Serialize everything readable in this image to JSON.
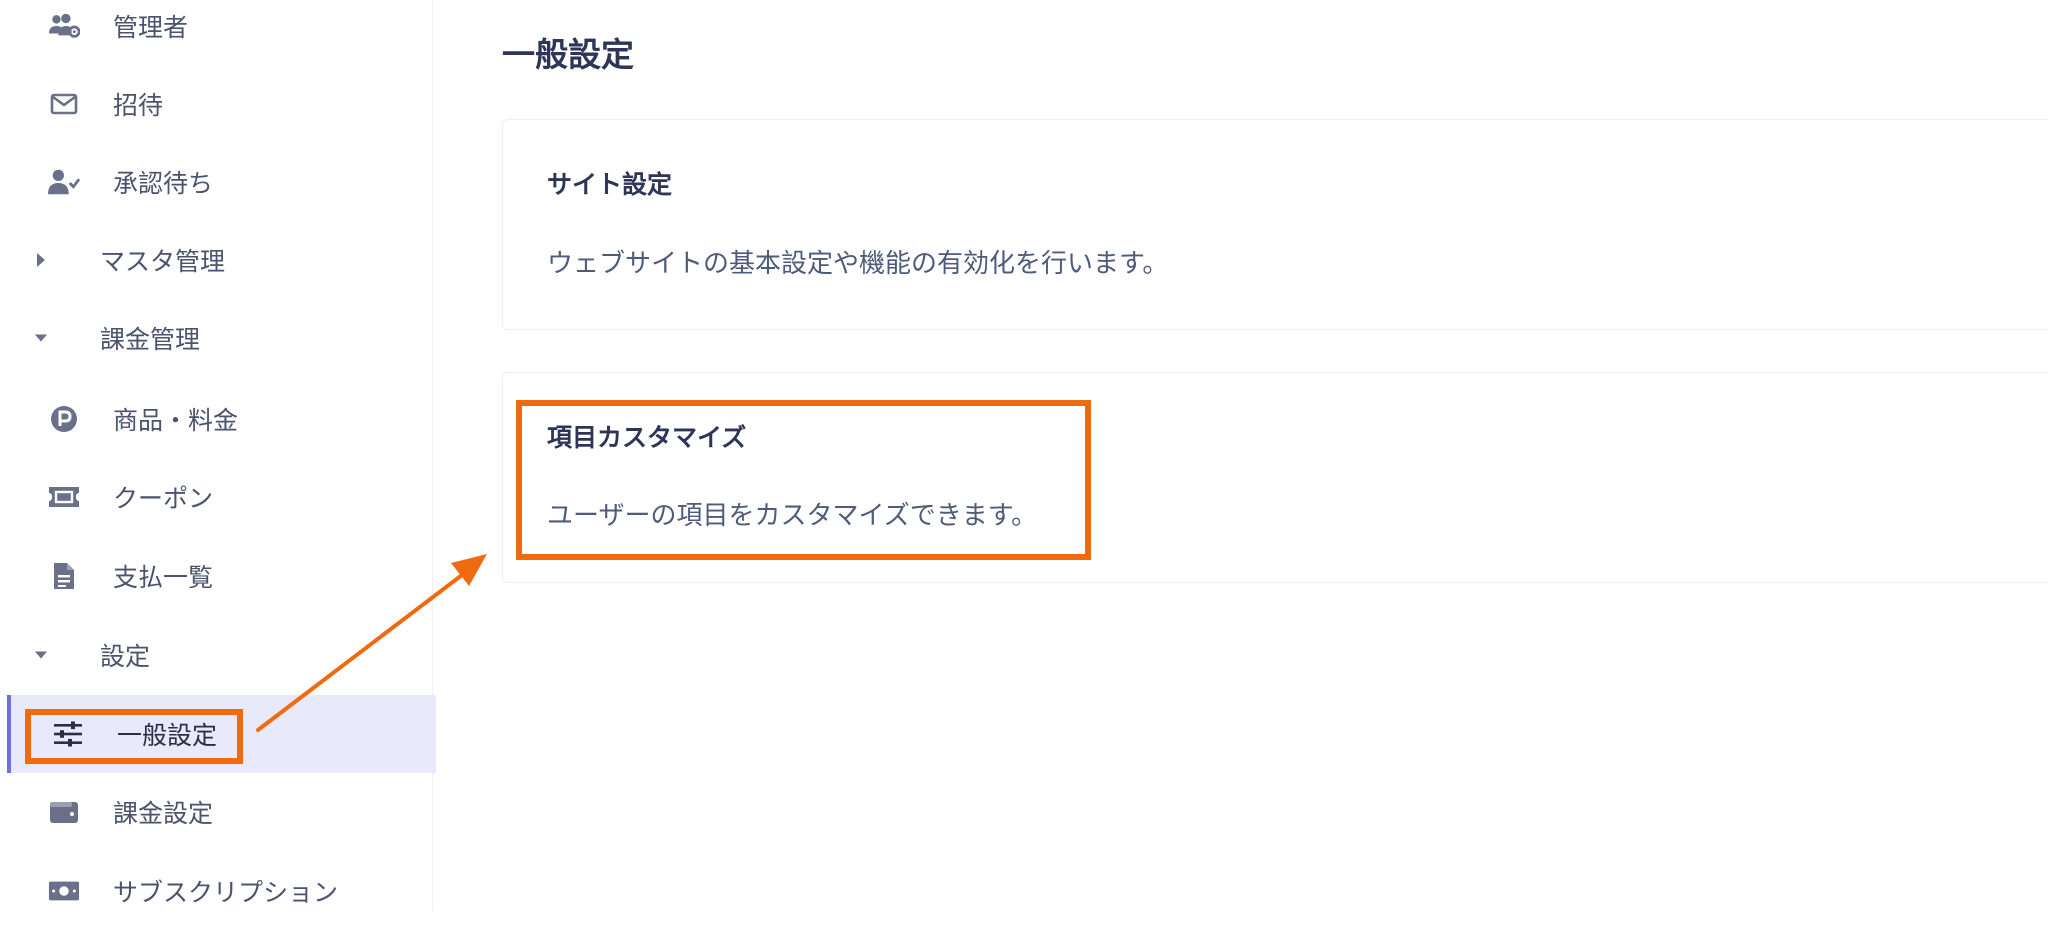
{
  "sidebar": {
    "items": [
      {
        "label": "管理者",
        "icon": "users-gear-icon"
      },
      {
        "label": "招待",
        "icon": "envelope-icon"
      },
      {
        "label": "承認待ち",
        "icon": "user-check-icon"
      },
      {
        "label": "マスタ管理",
        "icon": "caret-right-icon"
      },
      {
        "label": "課金管理",
        "icon": "caret-down-icon"
      },
      {
        "label": "商品・料金",
        "icon": "parking-circle-icon"
      },
      {
        "label": "クーポン",
        "icon": "ticket-icon"
      },
      {
        "label": "支払一覧",
        "icon": "document-icon"
      },
      {
        "label": "設定",
        "icon": "caret-down-icon"
      },
      {
        "label": "一般設定",
        "icon": "sliders-icon",
        "active": true
      },
      {
        "label": "課金設定",
        "icon": "wallet-icon"
      },
      {
        "label": "サブスクリプション",
        "icon": "money-bill-icon"
      }
    ]
  },
  "main": {
    "title": "一般設定",
    "cards": [
      {
        "title": "サイト設定",
        "description": "ウェブサイトの基本設定や機能の有効化を行います。"
      },
      {
        "title": "項目カスタマイズ",
        "description": "ユーザーの項目をカスタマイズできます。"
      }
    ]
  },
  "colors": {
    "highlight": "#f06a0f",
    "active_bg": "#e8e9fa",
    "active_border": "#6c72d9",
    "title": "#2f3557"
  }
}
